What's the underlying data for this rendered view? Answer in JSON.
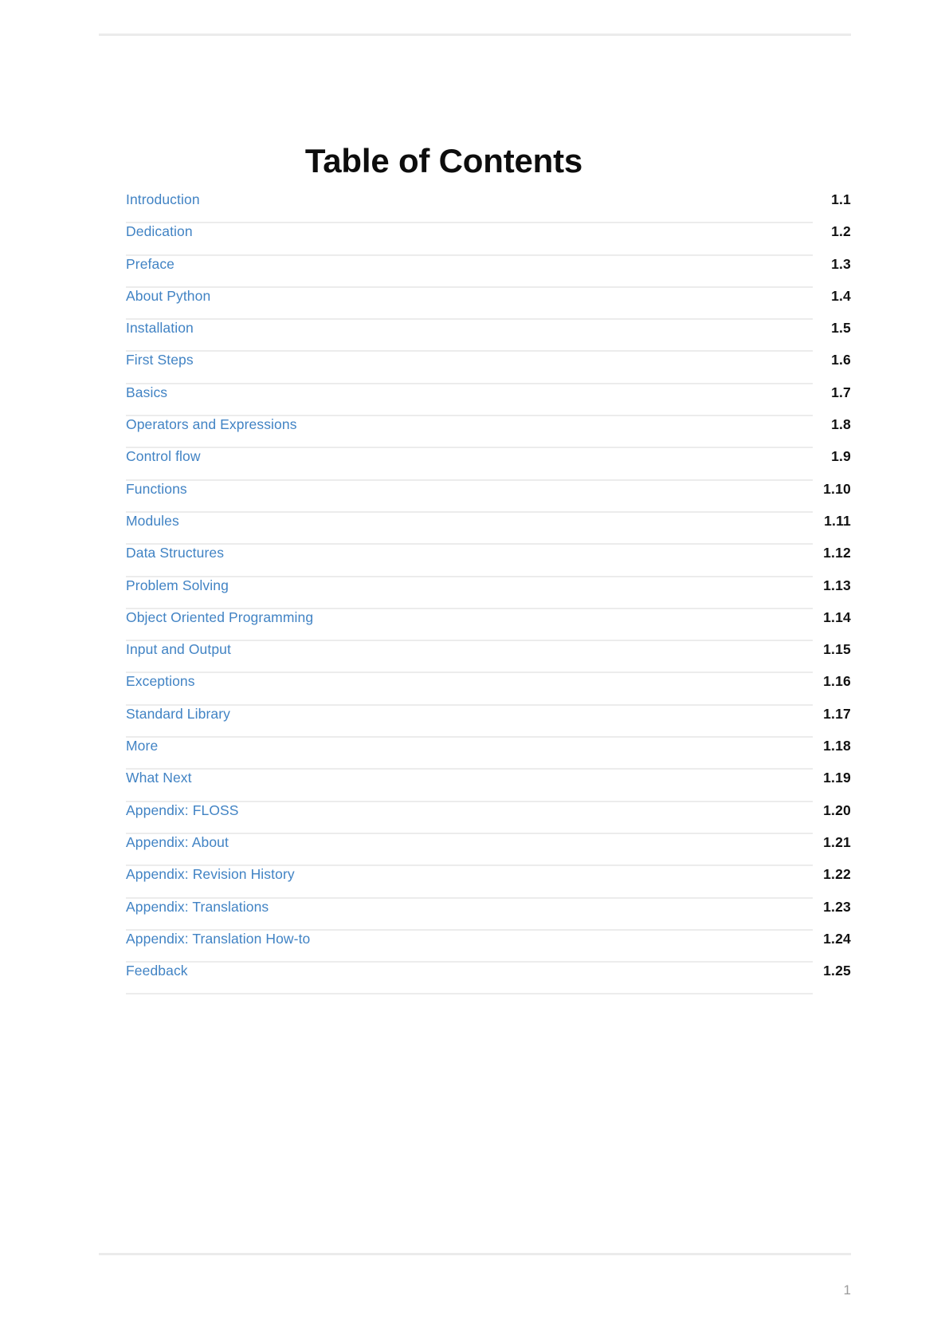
{
  "document": {
    "title": "Table of Contents",
    "footer_page_number": "1"
  },
  "colors": {
    "link": "#4183c4",
    "number": "#111111",
    "rule": "#ebebeb",
    "row_divider": "#ececec",
    "footer_text": "#9b9b9b"
  },
  "toc": {
    "entries": [
      {
        "label": "Introduction",
        "number": "1.1"
      },
      {
        "label": "Dedication",
        "number": "1.2"
      },
      {
        "label": "Preface",
        "number": "1.3"
      },
      {
        "label": "About Python",
        "number": "1.4"
      },
      {
        "label": "Installation",
        "number": "1.5"
      },
      {
        "label": "First Steps",
        "number": "1.6"
      },
      {
        "label": "Basics",
        "number": "1.7"
      },
      {
        "label": "Operators and Expressions",
        "number": "1.8"
      },
      {
        "label": "Control flow",
        "number": "1.9"
      },
      {
        "label": "Functions",
        "number": "1.10"
      },
      {
        "label": "Modules",
        "number": "1.11"
      },
      {
        "label": "Data Structures",
        "number": "1.12"
      },
      {
        "label": "Problem Solving",
        "number": "1.13"
      },
      {
        "label": "Object Oriented Programming",
        "number": "1.14"
      },
      {
        "label": "Input and Output",
        "number": "1.15"
      },
      {
        "label": "Exceptions",
        "number": "1.16"
      },
      {
        "label": "Standard Library",
        "number": "1.17"
      },
      {
        "label": "More",
        "number": "1.18"
      },
      {
        "label": "What Next",
        "number": "1.19"
      },
      {
        "label": "Appendix: FLOSS",
        "number": "1.20"
      },
      {
        "label": "Appendix: About",
        "number": "1.21"
      },
      {
        "label": "Appendix: Revision History",
        "number": "1.22"
      },
      {
        "label": "Appendix: Translations",
        "number": "1.23"
      },
      {
        "label": "Appendix: Translation How-to",
        "number": "1.24"
      },
      {
        "label": "Feedback",
        "number": "1.25"
      }
    ]
  }
}
